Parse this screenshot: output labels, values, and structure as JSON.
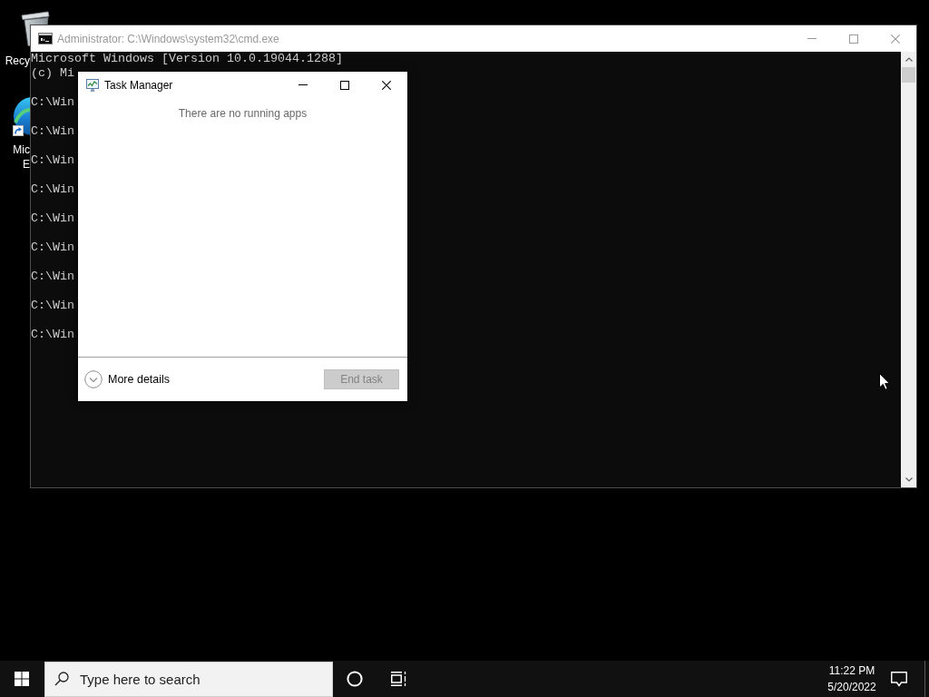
{
  "desktop_icons": [
    {
      "kind": "recycle_bin",
      "label_lines": [
        "Recy"
      ]
    },
    {
      "kind": "browser",
      "shortcut": true,
      "label_lines": [
        "Mic",
        "E"
      ]
    }
  ],
  "windows": [
    {
      "kind": "console",
      "title": "Administrator: C:\\Windows\\system32\\cmd.exe",
      "active": false,
      "lines": [
        {
          "kind": "text",
          "text": "Microsoft Windows [Version 10.0.19044.1288]"
        },
        {
          "kind": "text",
          "text": "(c) Mi"
        },
        {
          "kind": "blank"
        },
        {
          "kind": "text",
          "text": "C:\\Win"
        },
        {
          "kind": "blank"
        },
        {
          "kind": "text",
          "text": "C:\\Win"
        },
        {
          "kind": "blank"
        },
        {
          "kind": "text",
          "text": "C:\\Win"
        },
        {
          "kind": "blank"
        },
        {
          "kind": "text",
          "text": "C:\\Win"
        },
        {
          "kind": "blank"
        },
        {
          "kind": "text",
          "text": "C:\\Win"
        },
        {
          "kind": "blank"
        },
        {
          "kind": "text",
          "text": "C:\\Win"
        },
        {
          "kind": "blank"
        },
        {
          "kind": "text",
          "text": "C:\\Win"
        },
        {
          "kind": "blank"
        },
        {
          "kind": "text",
          "text": "C:\\Win"
        },
        {
          "kind": "blank"
        },
        {
          "kind": "text",
          "text": "C:\\Win"
        }
      ]
    },
    {
      "kind": "task_manager",
      "title": "Task Manager",
      "active": true,
      "message": "There are no running apps",
      "more_details": {
        "label": "More details",
        "expanded": false
      },
      "end_task": {
        "label": "End task",
        "disabled": true
      }
    }
  ],
  "taskbar": {
    "search": {
      "placeholder": "Type here to search"
    },
    "time": "11:22 PM",
    "date": "5/20/2022"
  }
}
